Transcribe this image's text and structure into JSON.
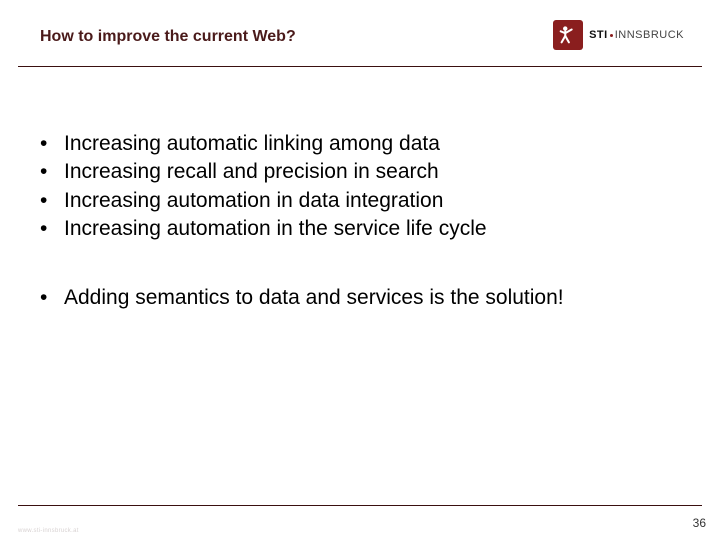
{
  "header": {
    "title": "How to improve the current Web?",
    "logo": {
      "mark_name": "sti-logo-mark",
      "text_bold": "STI",
      "text_light": "INNSBRUCK"
    }
  },
  "bullets_group1": [
    "Increasing automatic linking among data",
    "Increasing recall and precision in search",
    "Increasing automation in data integration",
    "Increasing automation in the service life cycle"
  ],
  "bullets_group2": [
    "Adding semantics to data and services is the solution!"
  ],
  "page_number": "36",
  "footer_watermark": "www.sti-innsbruck.at"
}
